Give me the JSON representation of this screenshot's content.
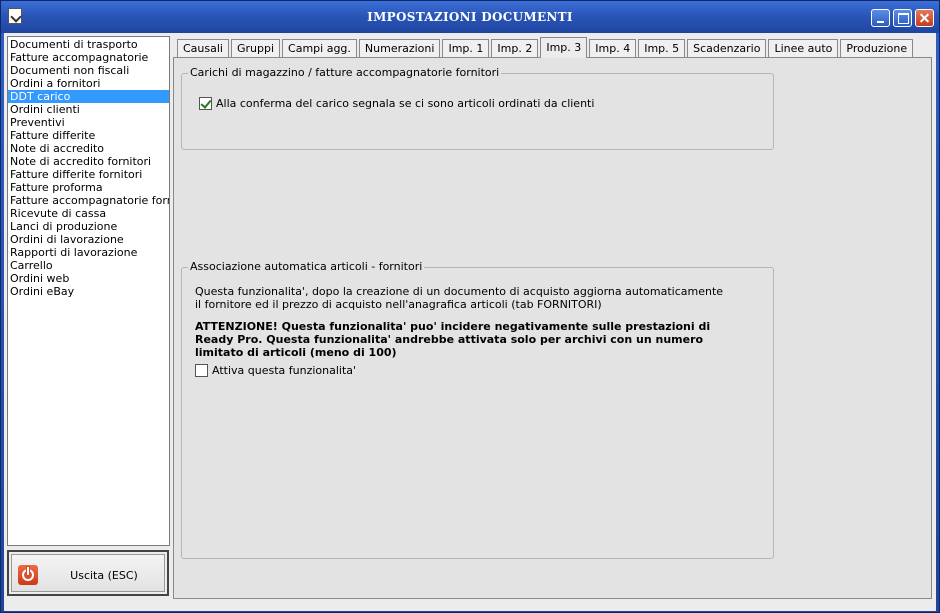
{
  "window": {
    "title": "IMPOSTAZIONI DOCUMENTI"
  },
  "doc_list": {
    "items": [
      "Documenti di trasporto",
      "Fatture accompagnatorie",
      "Documenti non fiscali",
      "Ordini a fornitori",
      "DDT carico",
      "Ordini clienti",
      "Preventivi",
      "Fatture differite",
      "Note di accredito",
      "Note di accredito fornitori",
      "Fatture differite fornitori",
      "Fatture proforma",
      "Fatture accompagnatorie fornitori",
      "Ricevute di cassa",
      "Lanci di produzione",
      "Ordini di lavorazione",
      "Rapporti di lavorazione",
      "Carrello",
      "Ordini web",
      "Ordini eBay"
    ],
    "selected": "DDT carico"
  },
  "exit_button": {
    "label": "Uscita (ESC)"
  },
  "tabs": {
    "items": [
      "Causali",
      "Gruppi",
      "Campi agg.",
      "Numerazioni",
      "Imp. 1",
      "Imp. 2",
      "Imp. 3",
      "Imp. 4",
      "Imp. 5",
      "Scadenzario",
      "Linee auto",
      "Produzione"
    ],
    "active": "Imp. 3"
  },
  "group_carichi": {
    "title": "Carichi di magazzino / fatture accompagnatorie fornitori",
    "checkbox_label": "Alla conferma del carico segnala se ci sono articoli ordinati da clienti",
    "checked": true
  },
  "group_associazione": {
    "title": "Associazione automatica articoli - fornitori",
    "description_1": "Questa funzionalita', dopo la creazione di un documento di acquisto aggiorna automaticamente",
    "description_2": "il fornitore ed il prezzo di acquisto nell'anagrafica articoli (tab FORNITORI)",
    "warning_1": "ATTENZIONE! Questa funzionalita' puo' incidere negativamente sulle prestazioni di",
    "warning_2": "Ready Pro. Questa funzionalita' andrebbe attivata solo per archivi con un numero",
    "warning_3": "limitato di articoli (meno di 100)",
    "checkbox_label": "Attiva questa funzionalita'",
    "checked": false
  }
}
